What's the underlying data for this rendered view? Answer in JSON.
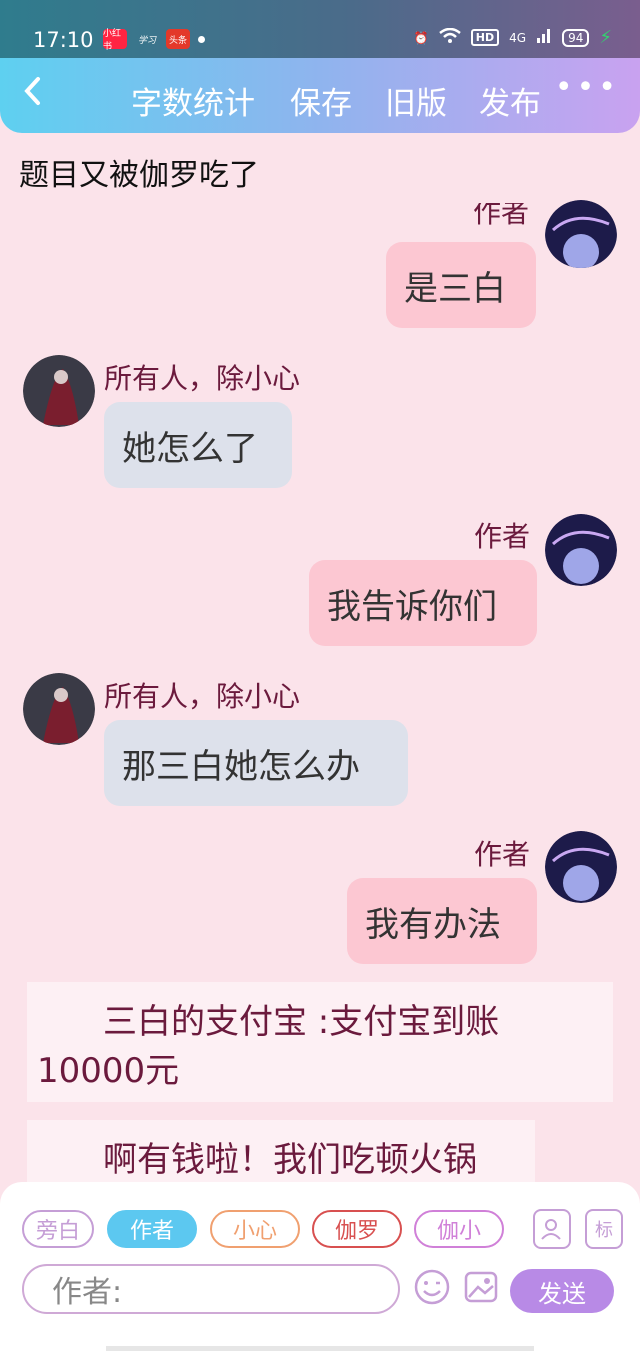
{
  "status_bar": {
    "time": "17:10",
    "apps": [
      "小红书",
      "学习",
      "头条"
    ],
    "network": "4G",
    "hd": "HD",
    "battery": "94"
  },
  "header": {
    "back_icon": "chevron-left-icon",
    "buttons": [
      "字数统计",
      "保存",
      "旧版",
      "发布"
    ],
    "more_icon": "more-dots-icon",
    "more_glyph": "•••"
  },
  "story_title": "题目又被伽罗吃了",
  "messages": [
    {
      "side": "right",
      "name": "作者",
      "text": "是三白",
      "name_clipped": true
    },
    {
      "side": "left",
      "name": "所有人，除小心",
      "text": "她怎么了"
    },
    {
      "side": "right",
      "name": "作者",
      "text": "我告诉你们"
    },
    {
      "side": "left",
      "name": "所有人，除小心",
      "text": "那三白她怎么办"
    },
    {
      "side": "right",
      "name": "作者",
      "text": "我有办法"
    }
  ],
  "narrations": [
    {
      "line1": "三白的支付宝 :支付宝到账",
      "line2": "10000元"
    },
    {
      "line1": "啊有钱啦！我们吃顿火锅"
    }
  ],
  "composer": {
    "roles": [
      {
        "label": "旁白",
        "color": "#c59ed6",
        "active": false
      },
      {
        "label": "作者",
        "color": "#5cc8f0",
        "active": true
      },
      {
        "label": "小心",
        "color": "#f0a070",
        "active": false
      },
      {
        "label": "伽罗",
        "color": "#d85050",
        "active": false
      },
      {
        "label": "伽小",
        "color": "#d080d8",
        "active": false
      }
    ],
    "contact_icon": "contact-card-icon",
    "tag_label": "标",
    "input_placeholder": "作者:",
    "emoji_icon": "emoji-icon",
    "image_icon": "image-icon",
    "send_label": "发送"
  }
}
